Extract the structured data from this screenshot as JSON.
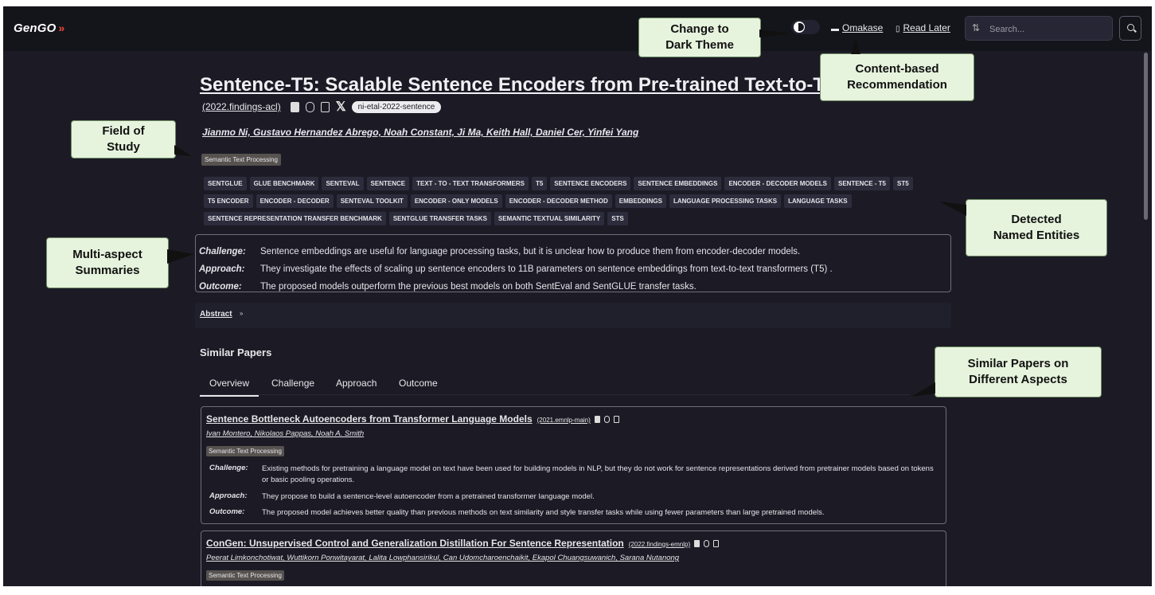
{
  "nav": {
    "logo": "GenGO",
    "omakase": "Omakase",
    "read_later": "Read Later",
    "search_placeholder": "Search..."
  },
  "paper": {
    "title": "Sentence-T5: Scalable Sentence Encoders from Pre-trained Text-to-Te",
    "venue": "(2022.findings-acl)",
    "citation_key": "ni-etal-2022-sentence",
    "authors": "Jianmo Ni, Gustavo Hernandez Abrego, Noah Constant, Ji Ma, Keith Hall, Daniel Cer, Yinfei Yang",
    "field": "Semantic Text Processing",
    "tags": [
      "SENTGLUE",
      "GLUE BENCHMARK",
      "SENTEVAL",
      "SENTENCE",
      "TEXT - TO - TEXT TRANSFORMERS",
      "T5",
      "SENTENCE ENCODERS",
      "SENTENCE EMBEDDINGS",
      "ENCODER - DECODER MODELS",
      "SENTENCE - T5",
      "ST5",
      "T5 ENCODER",
      "ENCODER - DECODER",
      "SENTEVAL TOOLKIT",
      "ENCODER - ONLY MODELS",
      "ENCODER - DECODER METHOD",
      "EMBEDDINGS",
      "LANGUAGE PROCESSING TASKS",
      "LANGUAGE TASKS",
      "SENTENCE REPRESENTATION TRANSFER BENCHMARK",
      "SENTGLUE TRANSFER TASKS",
      "SEMANTIC TEXTUAL SIMILARITY",
      "STS"
    ],
    "summary": {
      "challenge_label": "Challenge:",
      "challenge": "Sentence embeddings are useful for language processing tasks, but it is unclear how to produce them from encoder-decoder models.",
      "approach_label": "Approach:",
      "approach": "They investigate the effects of scaling up sentence encoders to 11B parameters on sentence embeddings from text-to-text transformers (T5) .",
      "outcome_label": "Outcome:",
      "outcome": "The proposed models outperform the previous best models on both SentEval and SentGLUE transfer tasks."
    },
    "abstract_label": "Abstract",
    "abstract_icon": "»"
  },
  "similar": {
    "heading": "Similar Papers",
    "tabs": [
      "Overview",
      "Challenge",
      "Approach",
      "Outcome"
    ],
    "cards": [
      {
        "title": "Sentence Bottleneck Autoencoders from Transformer Language Models",
        "venue": "(2021.emnlp-main)",
        "authors": "Ivan Montero, Nikolaos Pappas, Noah A. Smith",
        "field": "Semantic Text Processing",
        "challenge": "Existing methods for pretraining a language model on text have been used for building models in NLP, but they do not work for sentence representations derived from pretrainer models based on tokens or basic pooling operations.",
        "approach": "They propose to build a sentence-level autoencoder from a pretrained transformer language model.",
        "outcome": "The proposed model achieves better quality than previous methods on text similarity and style transfer tasks while using fewer parameters than large pretrained models."
      },
      {
        "title": "ConGen: Unsupervised Control and Generalization Distillation For Sentence Representation",
        "venue": "(2022.findings-emnlp)",
        "authors": "Peerat Limkonchotiwat, Wuttikorn Ponwitayarat, Lalita Lowphansirikul, Can Udomcharoenchaikit, Ekapol Chuangsuwanich, Sarana Nutanong",
        "field": "Semantic Text Processing"
      }
    ]
  },
  "card_labels": {
    "challenge": "Challenge:",
    "approach": "Approach:",
    "outcome": "Outcome:"
  },
  "callouts": {
    "dark_theme": "Change to\nDark Theme",
    "content_rec": "Content-based\nRecommendation",
    "field": "Field of\nStudy",
    "entities": "Detected\nNamed Entities",
    "summaries": "Multi-aspect\nSummaries",
    "similar": "Similar Papers on\nDifferent Aspects"
  },
  "colors": {
    "background": "#1c1b25",
    "nav": "#14141b",
    "callout_bg": "#e6f3dd",
    "logo_accent": "#ef4a3a"
  }
}
